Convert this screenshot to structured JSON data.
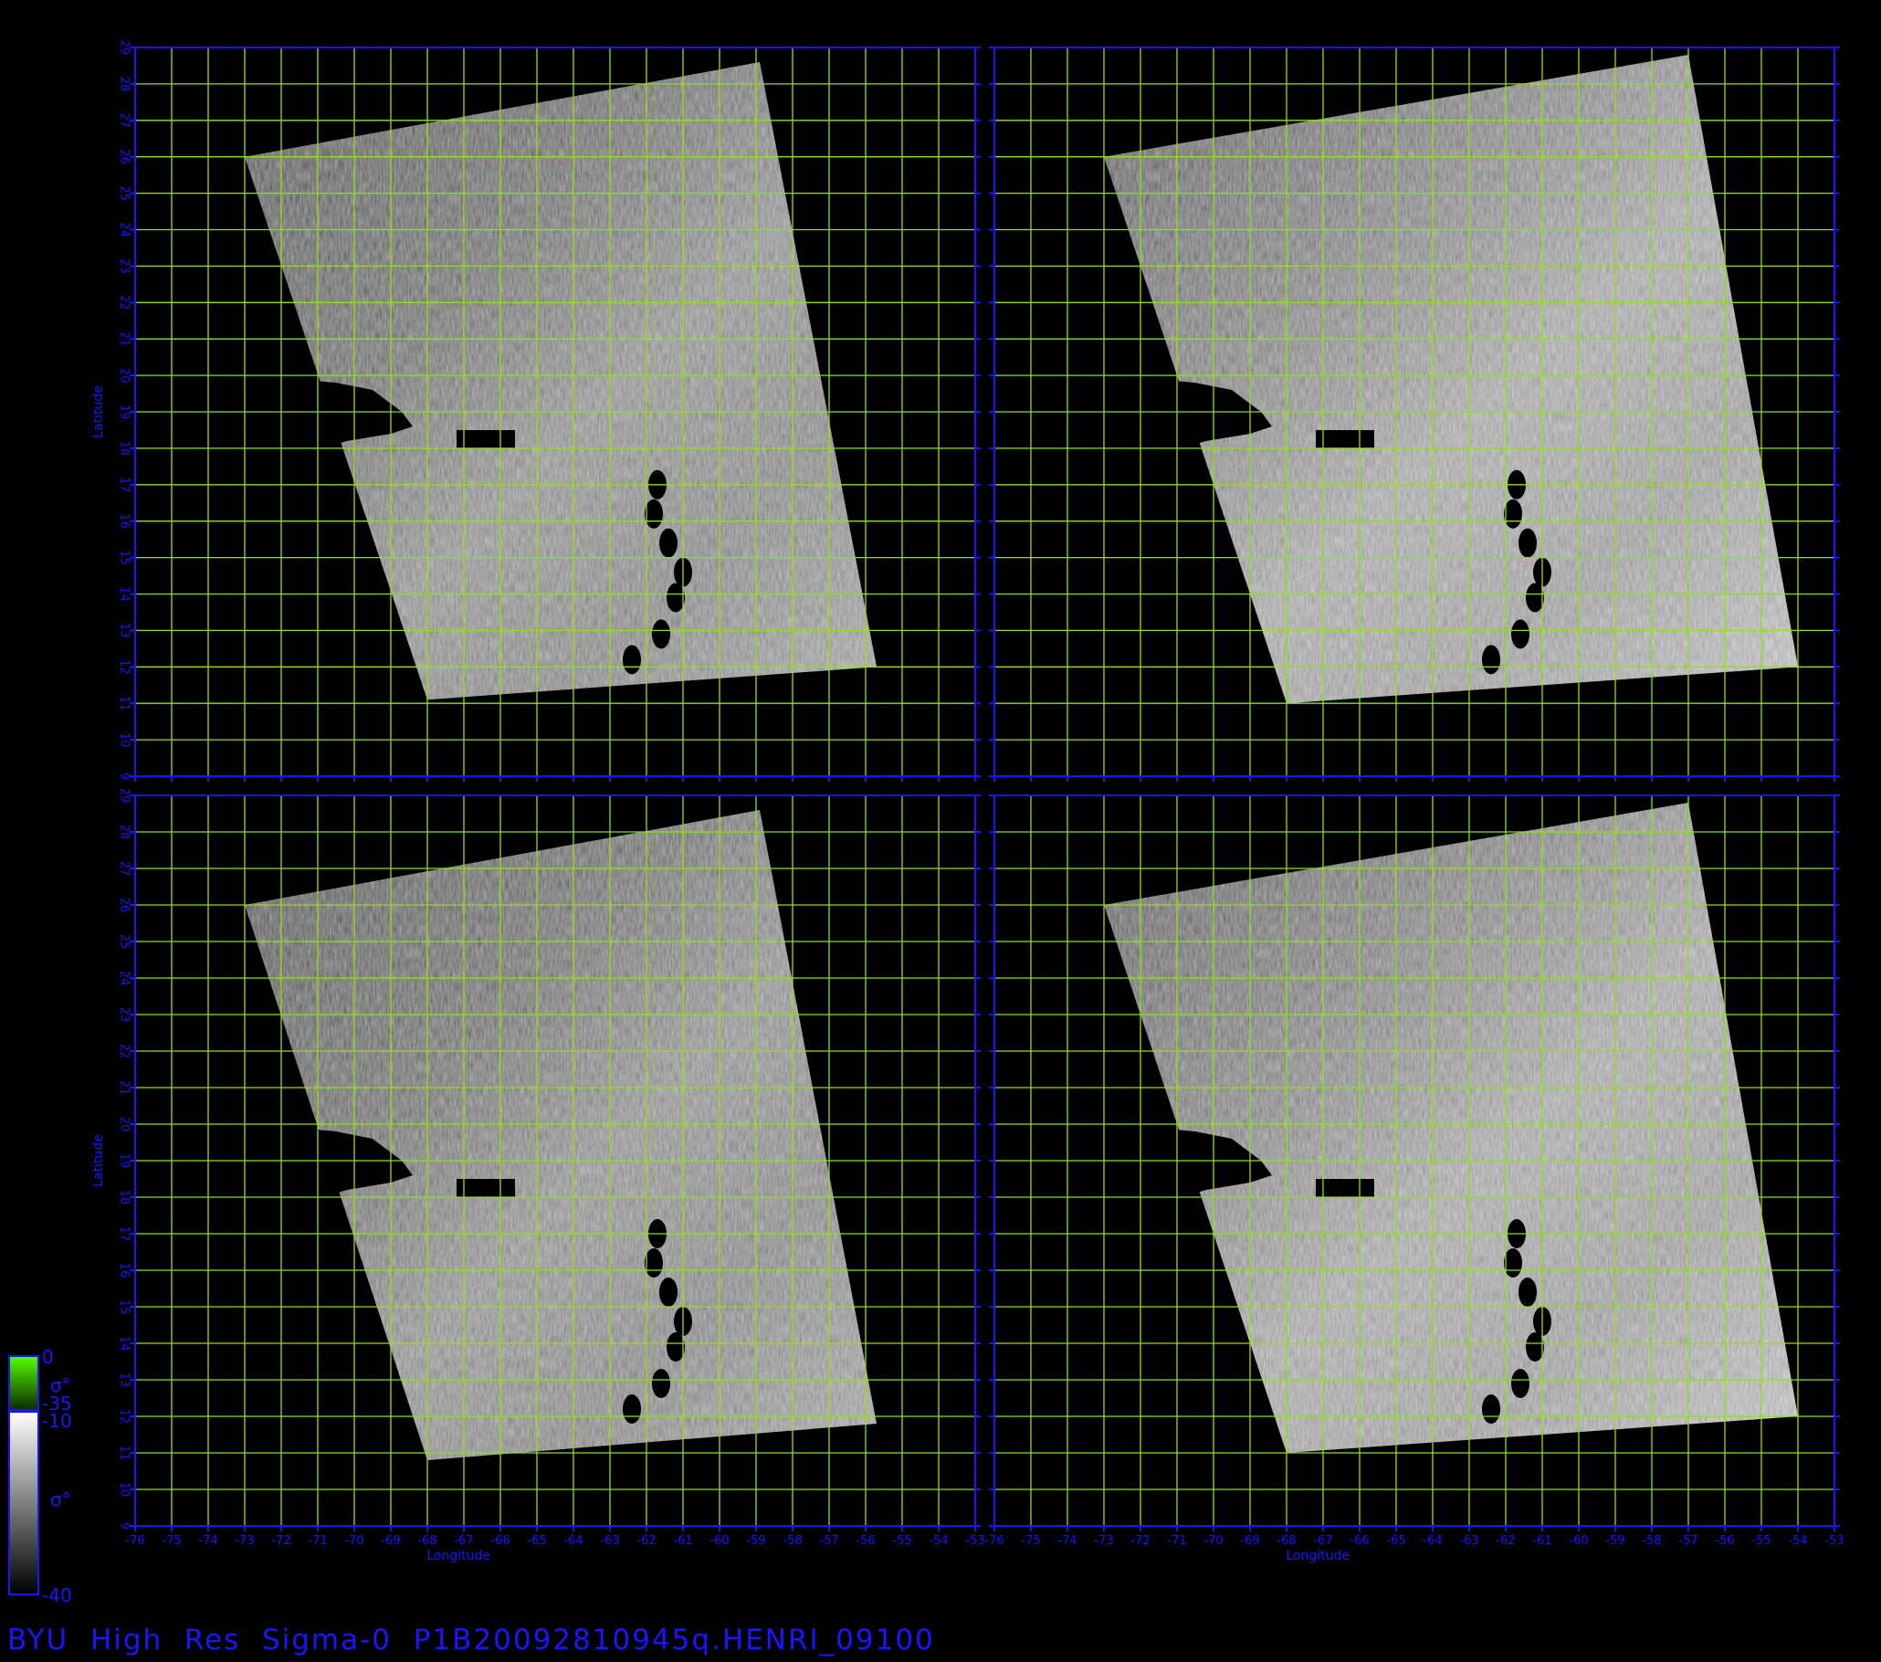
{
  "footer": {
    "title": "BYU  High  Res  Sigma-0  P1B20092810945q.HENRI_09100"
  },
  "axes": {
    "xlabel": "Longitude",
    "ylabel": "Latitude",
    "xlim": [
      -76,
      -53
    ],
    "ylim": [
      9,
      29
    ],
    "xticks": [
      "-76",
      "-75",
      "-74",
      "-73",
      "-72",
      "-71",
      "-70",
      "-69",
      "-68",
      "-67",
      "-66",
      "-65",
      "-64",
      "-63",
      "-62",
      "-61",
      "-60",
      "-59",
      "-58",
      "-57",
      "-56",
      "-55",
      "-54",
      "-53"
    ],
    "yticks": [
      "9",
      "10",
      "11",
      "12",
      "13",
      "14",
      "15",
      "16",
      "17",
      "18",
      "19",
      "20",
      "21",
      "22",
      "23",
      "24",
      "25",
      "26",
      "27",
      "28",
      "29"
    ],
    "grid": true,
    "axis_color": "#1a14ff",
    "grid_color": "#8ee01a"
  },
  "colorbar": {
    "land": {
      "max_label": "0",
      "min_label": "-35",
      "symbol": "σ°",
      "color": "#3ccf00"
    },
    "ocean": {
      "max_label": "-10",
      "min_label": "-40",
      "symbol": "σ°"
    }
  },
  "panels": [
    {
      "id": "top-left",
      "swath": [
        [
          -73.0,
          26.0
        ],
        [
          -58.9,
          28.6
        ],
        [
          -55.7,
          12.0
        ],
        [
          -68.0,
          11.1
        ]
      ],
      "landfall": "left-low"
    },
    {
      "id": "top-right",
      "swath": [
        [
          -73.0,
          26.0
        ],
        [
          -57.0,
          28.8
        ],
        [
          -54.0,
          12.0
        ],
        [
          -68.0,
          11.0
        ]
      ],
      "landfall": "left-low"
    },
    {
      "id": "bottom-left",
      "swath": [
        [
          -73.0,
          26.0
        ],
        [
          -58.9,
          28.6
        ],
        [
          -55.7,
          11.8
        ],
        [
          -68.0,
          10.8
        ]
      ],
      "landfall": "left-low"
    },
    {
      "id": "bottom-right",
      "swath": [
        [
          -73.0,
          26.0
        ],
        [
          -57.0,
          28.8
        ],
        [
          -54.0,
          12.0
        ],
        [
          -68.0,
          11.0
        ]
      ],
      "landfall": "left-low"
    }
  ]
}
